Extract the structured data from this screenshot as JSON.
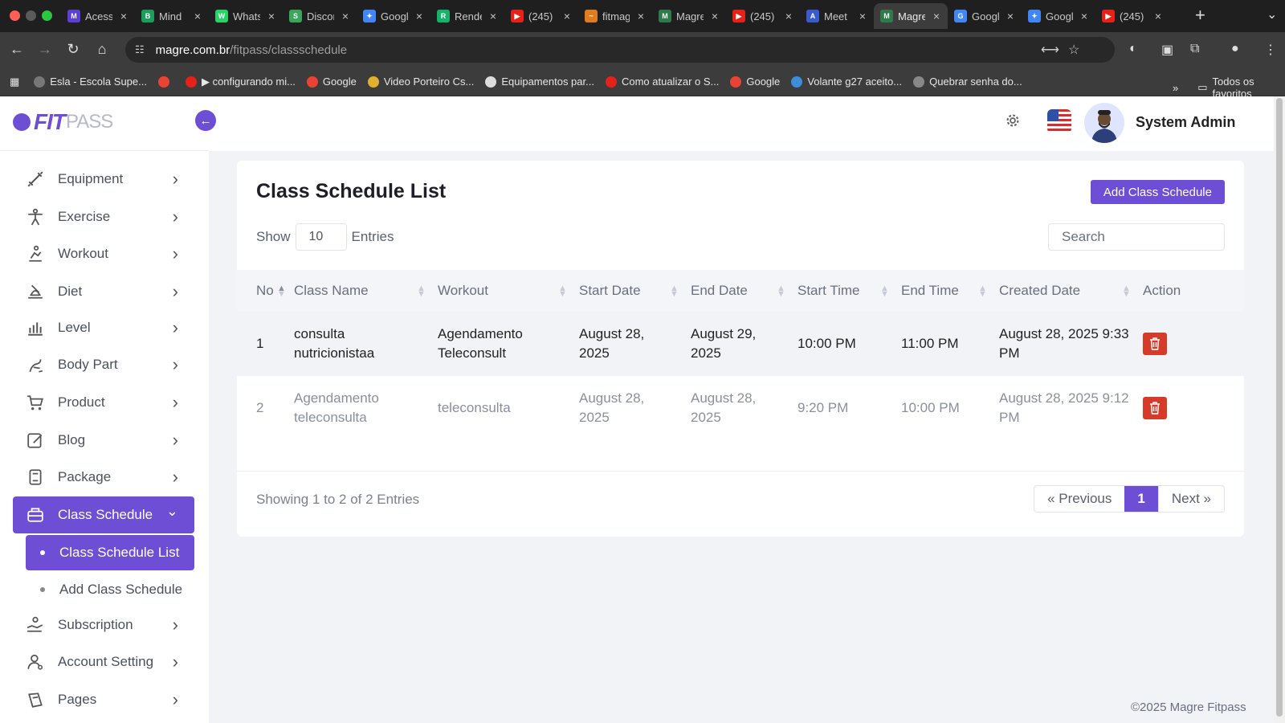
{
  "browser": {
    "tabs": [
      {
        "title": "Acesso",
        "color": "#5b3fd6",
        "glyph": "M"
      },
      {
        "title": "Mind",
        "color": "#1a9e5a",
        "glyph": "B"
      },
      {
        "title": "WhatsApp",
        "color": "#25d366",
        "glyph": "W"
      },
      {
        "title": "Discord",
        "color": "#3ba55c",
        "glyph": "S"
      },
      {
        "title": "Google",
        "color": "#4285f4",
        "glyph": "✦"
      },
      {
        "title": "Render",
        "color": "#17b26a",
        "glyph": "R"
      },
      {
        "title": "(245)",
        "color": "#e62117",
        "glyph": "▶"
      },
      {
        "title": "fitmag",
        "color": "#e07b20",
        "glyph": "~"
      },
      {
        "title": "Magre",
        "color": "#2f7a4a",
        "glyph": "M"
      },
      {
        "title": "(245)",
        "color": "#e62117",
        "glyph": "▶"
      },
      {
        "title": "Meet",
        "color": "#3a5bd0",
        "glyph": "A"
      },
      {
        "title": "Magre",
        "color": "#2f7a4a",
        "glyph": "M"
      },
      {
        "title": "Google",
        "color": "#4285f4",
        "glyph": "G"
      },
      {
        "title": "Google",
        "color": "#4285f4",
        "glyph": "✦"
      },
      {
        "title": "(245)",
        "color": "#e62117",
        "glyph": "▶"
      }
    ],
    "active_tab_index": 11,
    "url_host": "magre.com.br",
    "url_path": "/fitpass/classschedule",
    "bookmarks": [
      {
        "label": "Esla - Escola Supe...",
        "color": "#777"
      },
      {
        "label": "",
        "color": "#ea4335"
      },
      {
        "label": "▶ configurando mi...",
        "color": "#e62117"
      },
      {
        "label": "Google",
        "color": "#ea4335"
      },
      {
        "label": "Video Porteiro Cs...",
        "color": "#e0b030"
      },
      {
        "label": "Equipamentos par...",
        "color": "#ddd"
      },
      {
        "label": "Como atualizar o S...",
        "color": "#e62117"
      },
      {
        "label": "Google",
        "color": "#ea4335"
      },
      {
        "label": "Volante g27 aceito...",
        "color": "#3b8fd9"
      },
      {
        "label": "Quebrar senha do...",
        "color": "#888"
      }
    ],
    "all_bookmarks": "Todos os favoritos"
  },
  "app": {
    "logo_fit": "FIT",
    "logo_pass": "PASS",
    "user_name": "System Admin",
    "menu": [
      {
        "label": "Equipment",
        "icon": "dumbbell-icon"
      },
      {
        "label": "Exercise",
        "icon": "person-stretch-icon"
      },
      {
        "label": "Workout",
        "icon": "workout-icon"
      },
      {
        "label": "Diet",
        "icon": "diet-icon"
      },
      {
        "label": "Level",
        "icon": "bar-chart-icon"
      },
      {
        "label": "Body Part",
        "icon": "body-part-icon"
      },
      {
        "label": "Product",
        "icon": "cart-icon"
      },
      {
        "label": "Blog",
        "icon": "blog-icon"
      },
      {
        "label": "Package",
        "icon": "package-icon"
      },
      {
        "label": "Class Schedule",
        "icon": "class-schedule-icon"
      },
      {
        "label": "Subscription",
        "icon": "subscription-icon"
      },
      {
        "label": "Account Setting",
        "icon": "account-icon"
      },
      {
        "label": "Pages",
        "icon": "pages-icon"
      }
    ],
    "submenu": [
      {
        "label": "Class Schedule List"
      },
      {
        "label": "Add Class Schedule"
      }
    ],
    "page_title": "Class Schedule List",
    "add_button": "Add Class Schedule",
    "show_label": "Show",
    "entries_value": "10",
    "entries_label": "Entries",
    "search_placeholder": "Search",
    "columns": [
      "No",
      "Class Name",
      "Workout",
      "Start Date",
      "End Date",
      "Start Time",
      "End Time",
      "Created Date",
      "Action"
    ],
    "rows": [
      {
        "no": "1",
        "class_name": "consulta nutricionistaa",
        "workout": "Agendamento Teleconsult",
        "start_date": "August 28, 2025",
        "end_date": "August 29, 2025",
        "start_time": "10:00 PM",
        "end_time": "11:00 PM",
        "created": "August 28, 2025 9:33 PM"
      },
      {
        "no": "2",
        "class_name": "Agendamento teleconsulta",
        "workout": "teleconsulta",
        "start_date": "August 28, 2025",
        "end_date": "August 28, 2025",
        "start_time": "9:20 PM",
        "end_time": "10:00 PM",
        "created": "August 28, 2025 9:12 PM"
      }
    ],
    "info_text": "Showing 1 to 2 of 2 Entries",
    "pager": {
      "prev": "« Previous",
      "current": "1",
      "next": "Next »"
    },
    "footer": "©2025 Magre Fitpass",
    "accent": "#6f4ed6",
    "danger": "#d63b2a"
  }
}
